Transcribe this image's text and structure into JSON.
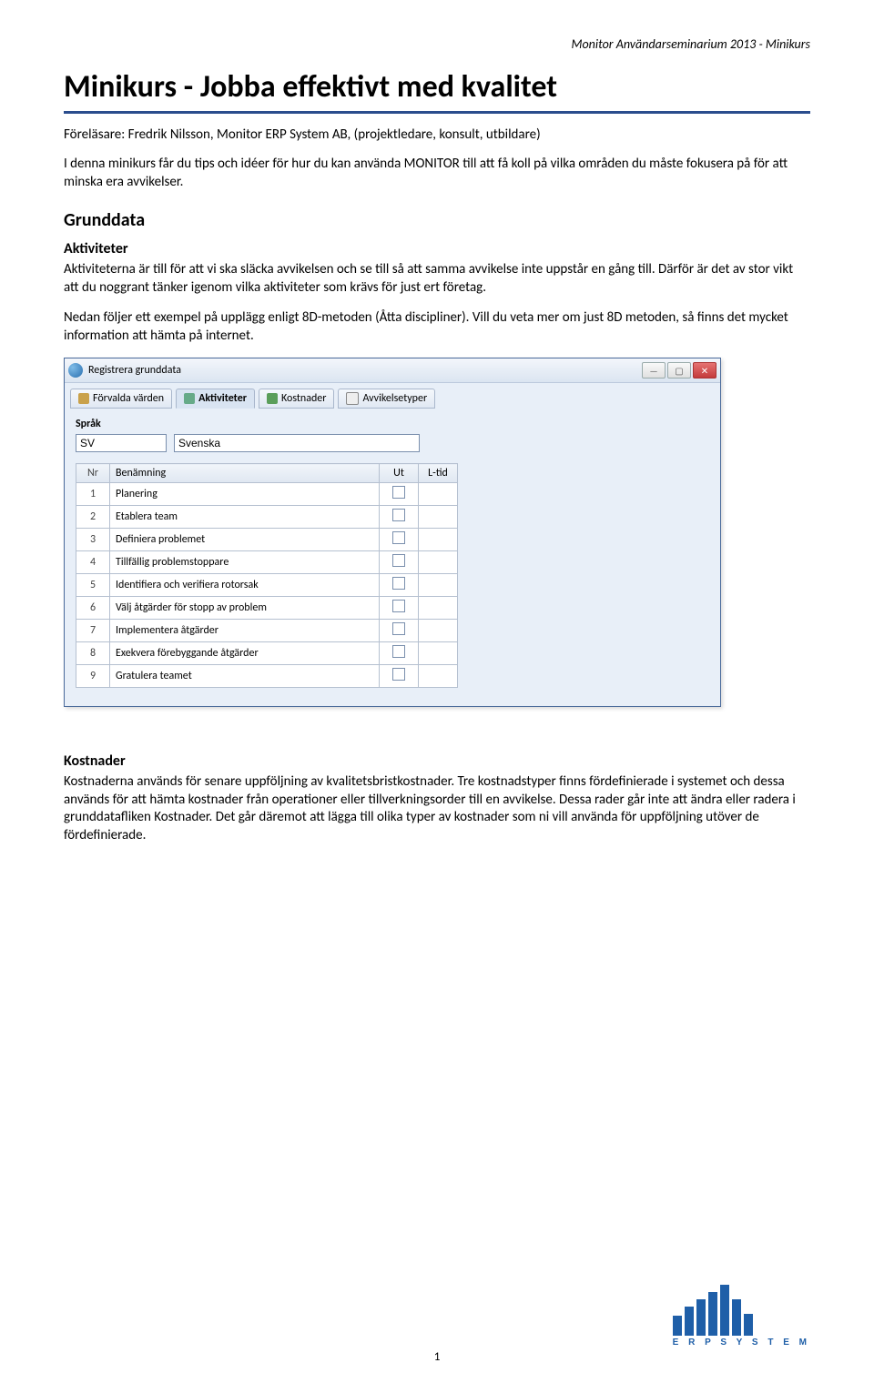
{
  "header_right": "Monitor Användarseminarium 2013 - Minikurs",
  "title": "Minikurs - Jobba effektivt med kvalitet",
  "lecturer": "Föreläsare: Fredrik Nilsson, Monitor ERP System AB, (projektledare, konsult, utbildare)",
  "intro": "I denna minikurs får du tips och idéer för hur du kan använda MONITOR till att få koll på vilka områden du måste fokusera på för att minska era avvikelser.",
  "h2_grunddata": "Grunddata",
  "h3_aktiviteter": "Aktiviteter",
  "p_aktiviteter1": "Aktiviteterna är till för att vi ska släcka avvikelsen och se till så att samma avvikelse inte uppstår en gång till. Därför är det av stor vikt att du noggrant tänker igenom vilka aktiviteter som krävs för just ert företag.",
  "p_aktiviteter2": "Nedan följer ett exempel på upplägg enligt 8D-metoden (Åtta discipliner). Vill du veta mer om just 8D metoden, så finns det mycket information att hämta på internet.",
  "window": {
    "title": "Registrera grunddata",
    "tabs": [
      "Förvalda värden",
      "Aktiviteter",
      "Kostnader",
      "Avvikelsetyper"
    ],
    "active_tab": 1,
    "lang_label": "Språk",
    "lang_code": "SV",
    "lang_text": "Svenska",
    "columns": [
      "Nr",
      "Benämning",
      "Ut",
      "L-tid"
    ],
    "rows": [
      {
        "nr": "1",
        "name": "Planering"
      },
      {
        "nr": "2",
        "name": "Etablera team"
      },
      {
        "nr": "3",
        "name": "Definiera problemet"
      },
      {
        "nr": "4",
        "name": "Tillfällig problemstoppare"
      },
      {
        "nr": "5",
        "name": "Identifiera och verifiera rotorsak"
      },
      {
        "nr": "6",
        "name": "Välj åtgärder för stopp av problem"
      },
      {
        "nr": "7",
        "name": "Implementera åtgärder"
      },
      {
        "nr": "8",
        "name": "Exekvera förebyggande åtgärder"
      },
      {
        "nr": "9",
        "name": "Gratulera teamet"
      }
    ]
  },
  "h3_kostnader": "Kostnader",
  "p_kostnader": "Kostnaderna används för senare uppföljning av kvalitetsbristkostnader. Tre kostnadstyper finns fördefinierade i systemet och dessa används för att hämta kostnader från operationer eller tillverkningsorder till en avvikelse. Dessa rader går inte att ändra eller radera i grunddatafliken Kostnader. Det går däremot att lägga till olika typer av kostnader som ni vill använda för uppföljning utöver de fördefinierade.",
  "logo_text": "E R P   S Y S T E M",
  "page_number": "1"
}
